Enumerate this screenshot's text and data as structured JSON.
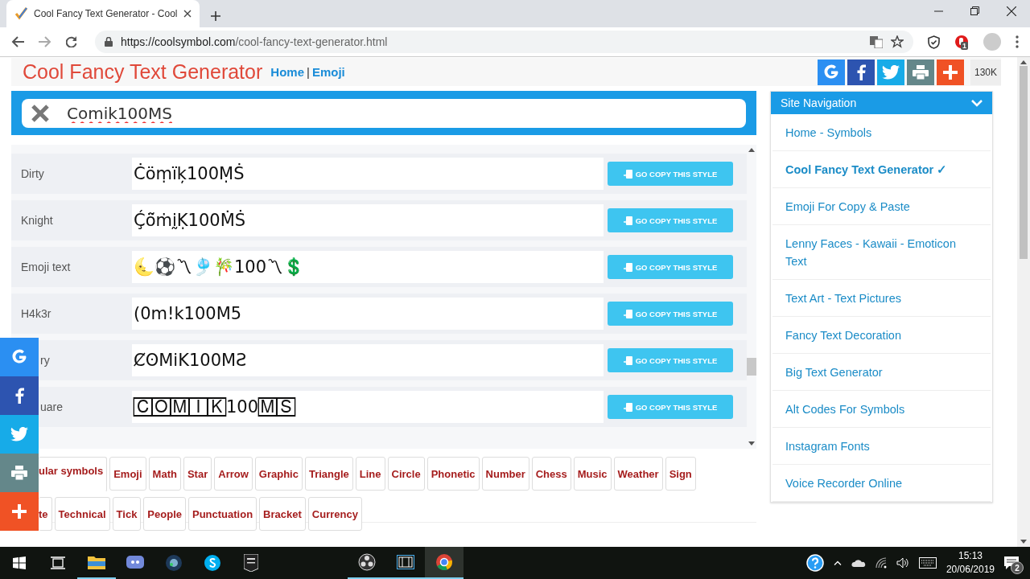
{
  "browser": {
    "tab": {
      "title": "Cool Fancy Text Generator - Cool"
    },
    "url": {
      "host": "https://coolsymbol.com",
      "path": "/cool-fancy-text-generator.html"
    },
    "extension_badge": "1"
  },
  "header": {
    "title": "Cool Fancy Text Generator",
    "links": [
      "Home",
      "Emoji"
    ],
    "separator": "|",
    "share_count": "130K"
  },
  "search": {
    "value": "Comik100MS"
  },
  "styles": [
    {
      "label": "Dirty",
      "label_cut": false,
      "text": "Ċöṃïķ100ṂṠ",
      "button": "GO COPY THIS STYLE"
    },
    {
      "label": "Knight",
      "label_cut": false,
      "text": "Ḉö̃ṁḭḲ100ṀṠ",
      "button": "GO COPY THIS STYLE"
    },
    {
      "label": "Emoji text",
      "label_cut": false,
      "text": "🌜⚽〽🎐🎋100〽💲",
      "button": "GO COPY THIS STYLE"
    },
    {
      "label": "H4k3r",
      "label_cut": false,
      "text": "(0m!k100M5",
      "button": "GO COPY THIS STYLE"
    },
    {
      "label": "ry",
      "label_cut": true,
      "text": "ȻʘMiK100MƧ",
      "button": "GO COPY THIS STYLE"
    },
    {
      "label": "uare",
      "label_cut": true,
      "text": "🄲🄾🄼🄸🄺100🄼🅂",
      "button": "GO COPY THIS STYLE"
    }
  ],
  "tag_rows": [
    [
      {
        "label": "ular symbols",
        "selected": true,
        "cut": true
      },
      {
        "label": "Emoji",
        "selected": false,
        "cut": false
      },
      {
        "label": "Math",
        "selected": false,
        "cut": false
      },
      {
        "label": "Star",
        "selected": false,
        "cut": false
      },
      {
        "label": "Arrow",
        "selected": false,
        "cut": false
      },
      {
        "label": "Graphic",
        "selected": false,
        "cut": false
      },
      {
        "label": "Triangle",
        "selected": false,
        "cut": false
      },
      {
        "label": "Line",
        "selected": false,
        "cut": false
      },
      {
        "label": "Circle",
        "selected": false,
        "cut": false
      },
      {
        "label": "Phonetic",
        "selected": false,
        "cut": false
      },
      {
        "label": "Number",
        "selected": false,
        "cut": false
      },
      {
        "label": "Chess",
        "selected": false,
        "cut": false
      },
      {
        "label": "Music",
        "selected": false,
        "cut": false
      },
      {
        "label": "Weather",
        "selected": false,
        "cut": false
      },
      {
        "label": "Sign",
        "selected": false,
        "cut": false
      }
    ],
    [
      {
        "label": "te",
        "selected": false,
        "cut": true
      },
      {
        "label": "Technical",
        "selected": false,
        "cut": false
      },
      {
        "label": "Tick",
        "selected": false,
        "cut": false
      },
      {
        "label": "People",
        "selected": false,
        "cut": false
      },
      {
        "label": "Punctuation",
        "selected": false,
        "cut": false
      },
      {
        "label": "Bracket",
        "selected": false,
        "cut": false
      },
      {
        "label": "Currency",
        "selected": false,
        "cut": false
      }
    ]
  ],
  "site_navigation": {
    "title": "Site Navigation",
    "items": [
      {
        "label": "Home - Symbols",
        "selected": false
      },
      {
        "label": "Cool Fancy Text Generator ✓",
        "selected": true
      },
      {
        "label": "Emoji For Copy & Paste",
        "selected": false
      },
      {
        "label": "Lenny Faces - Kawaii - Emoticon Text",
        "selected": false
      },
      {
        "label": "Text Art - Text Pictures",
        "selected": false
      },
      {
        "label": "Fancy Text Decoration",
        "selected": false
      },
      {
        "label": "Big Text Generator",
        "selected": false
      },
      {
        "label": "Alt Codes For Symbols",
        "selected": false
      },
      {
        "label": "Instagram Fonts",
        "selected": false
      },
      {
        "label": "Voice Recorder Online",
        "selected": false
      }
    ]
  },
  "taskbar": {
    "time": "15:13",
    "date": "20/06/2019",
    "notifications": "2"
  }
}
